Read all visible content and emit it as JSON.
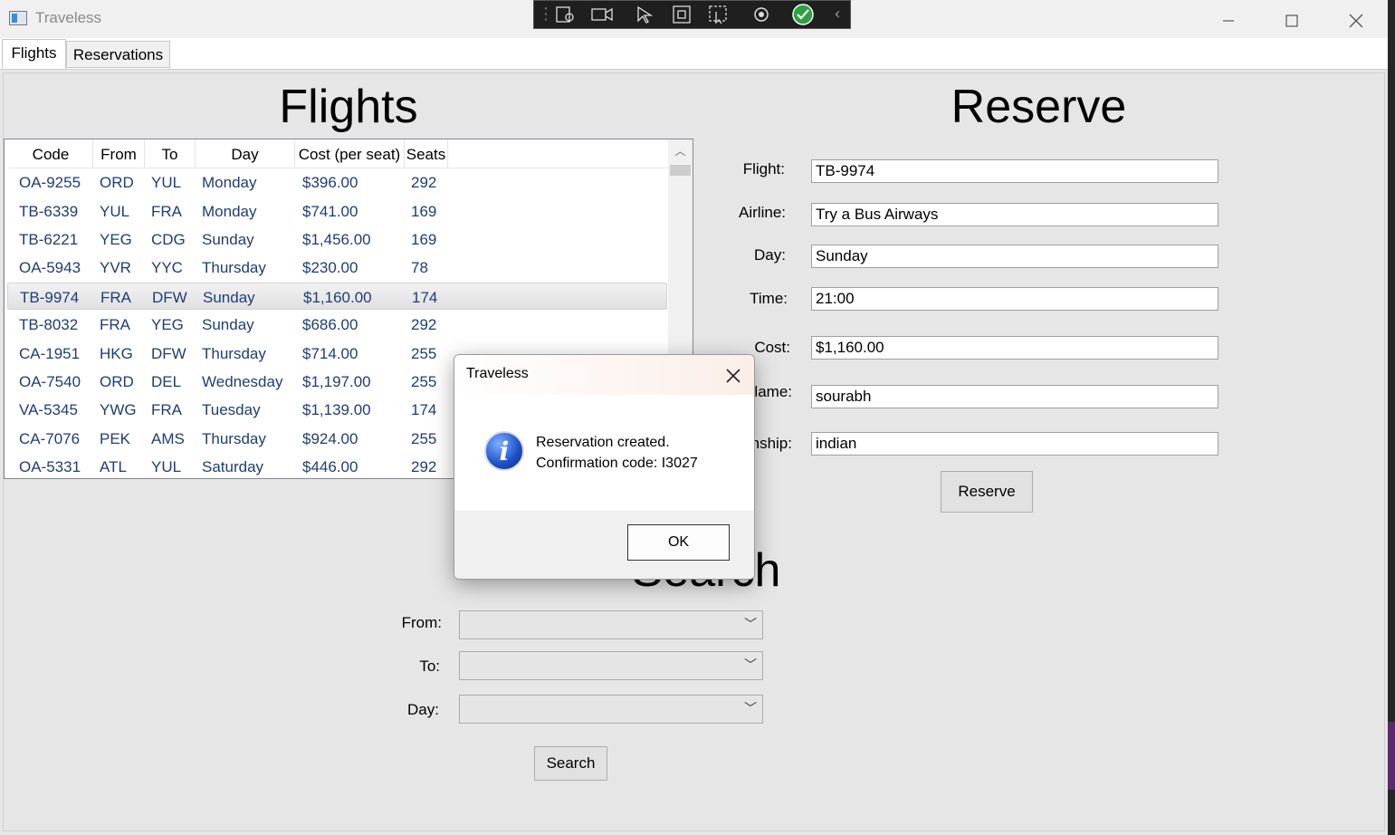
{
  "window": {
    "title": "Traveless"
  },
  "tabs": [
    {
      "label": "Flights"
    },
    {
      "label": "Reservations"
    }
  ],
  "flights_section": {
    "heading": "Flights",
    "columns": [
      "Code",
      "From",
      "To",
      "Day",
      "Cost (per seat)",
      "Seats"
    ],
    "rows": [
      [
        "OA-9255",
        "ORD",
        "YUL",
        "Monday",
        "$396.00",
        "292"
      ],
      [
        "TB-6339",
        "YUL",
        "FRA",
        "Monday",
        "$741.00",
        "169"
      ],
      [
        "TB-6221",
        "YEG",
        "CDG",
        "Sunday",
        "$1,456.00",
        "169"
      ],
      [
        "OA-5943",
        "YVR",
        "YYC",
        "Thursday",
        "$230.00",
        "78"
      ],
      [
        "TB-9974",
        "FRA",
        "DFW",
        "Sunday",
        "$1,160.00",
        "174"
      ],
      [
        "TB-8032",
        "FRA",
        "YEG",
        "Sunday",
        "$686.00",
        "292"
      ],
      [
        "CA-1951",
        "HKG",
        "DFW",
        "Thursday",
        "$714.00",
        "255"
      ],
      [
        "OA-7540",
        "ORD",
        "DEL",
        "Wednesday",
        "$1,197.00",
        "255"
      ],
      [
        "VA-5345",
        "YWG",
        "FRA",
        "Tuesday",
        "$1,139.00",
        "174"
      ],
      [
        "CA-7076",
        "PEK",
        "AMS",
        "Thursday",
        "$924.00",
        "255"
      ],
      [
        "OA-5331",
        "ATL",
        "YUL",
        "Saturday",
        "$446.00",
        "292"
      ]
    ]
  },
  "reserve_section": {
    "heading": "Reserve",
    "flight_label": "Flight:",
    "flight_value": "TB-9974",
    "airline_label": "Airline:",
    "airline_value": "Try a Bus Airways",
    "day_label": "Day:",
    "day_value": "Sunday",
    "time_label": "Time:",
    "time_value": "21:00",
    "cost_label": "Cost:",
    "cost_value": "$1,160.00",
    "name_label": "lame:",
    "name_value": "sourabh",
    "citizenship_label": "nship:",
    "citizenship_value": "indian",
    "reserve_button": "Reserve"
  },
  "search_section": {
    "heading": "Search",
    "from_label": "From:",
    "to_label": "To:",
    "day_label": "Day:",
    "search_button": "Search"
  },
  "dialog": {
    "title": "Traveless",
    "message_line1": "Reservation created.",
    "message_line2": "Confirmation code: I3027",
    "ok_button": "OK"
  }
}
